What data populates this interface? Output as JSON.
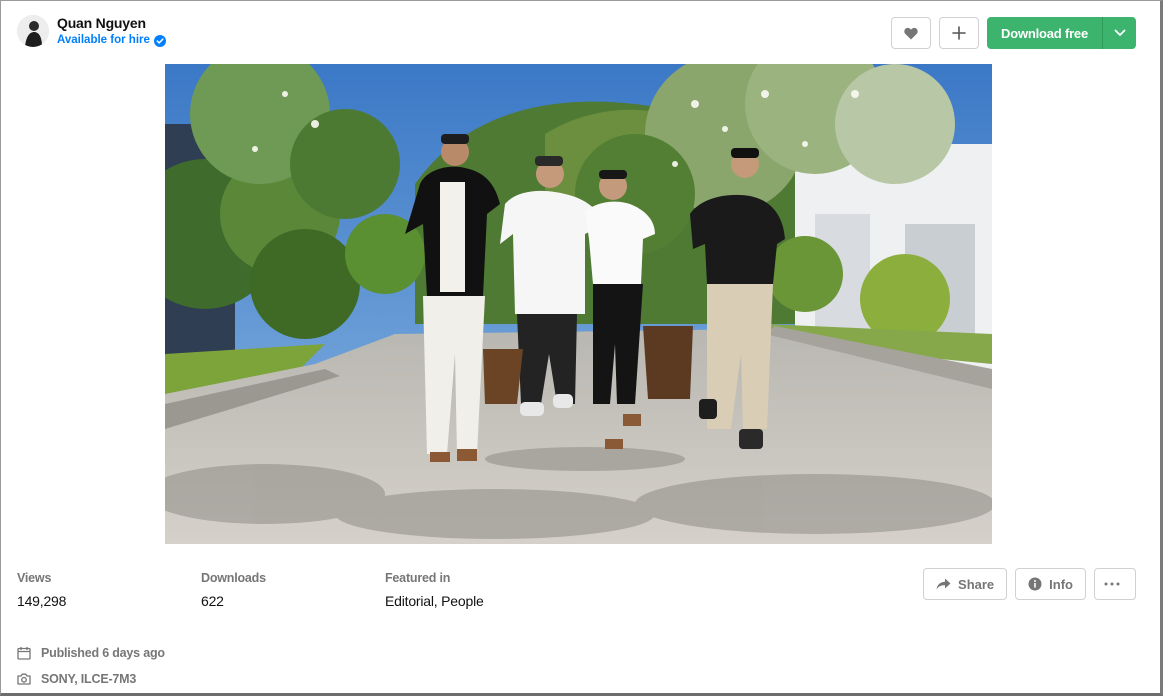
{
  "author": {
    "name": "Quan Nguyen",
    "status": "Available for hire"
  },
  "actions": {
    "like_icon": "heart-icon",
    "add_icon": "plus-icon",
    "download_label": "Download free",
    "download_menu_icon": "chevron-down-icon"
  },
  "photo": {
    "subject": "Four young men walking on a paved resort path with trees and hills behind"
  },
  "stats": {
    "views_label": "Views",
    "views_value": "149,298",
    "downloads_label": "Downloads",
    "downloads_value": "622",
    "featured_label": "Featured in",
    "featured_items": [
      "Editorial",
      "People"
    ],
    "featured_separator": ", "
  },
  "meta_actions": {
    "share_label": "Share",
    "info_label": "Info",
    "more_icon": "ellipsis-icon"
  },
  "details": {
    "published": "Published 6 days ago",
    "camera": "SONY, ILCE-7M3"
  },
  "colors": {
    "accent_green": "#3cb46e",
    "hire_blue": "#007fff",
    "muted_text": "#767676"
  }
}
